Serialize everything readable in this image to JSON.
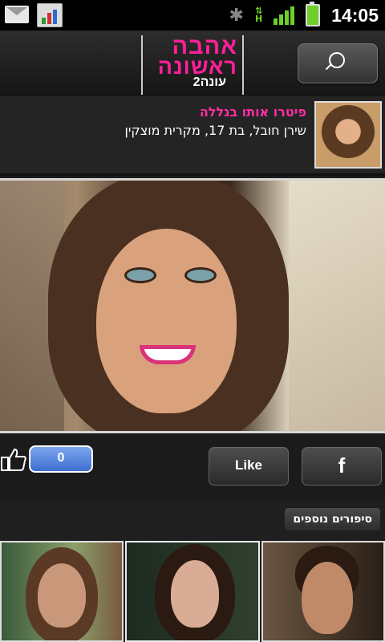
{
  "status_bar": {
    "time": "14:05",
    "icons": [
      "mail-icon",
      "stats-icon",
      "bluetooth-icon",
      "hspa-icon",
      "signal-icon",
      "battery-charging-icon"
    ]
  },
  "header": {
    "logo_line1": "אהבה",
    "logo_line2": "ראשונה",
    "logo_line3": "עונה2",
    "search_icon": "search-icon"
  },
  "story": {
    "title": "פיטרו אותו בגללה",
    "subtitle": "שירן חובל, בת 17, מקרית מוצקין"
  },
  "social": {
    "like_count": "0",
    "like_label": "Like",
    "facebook_label": "f",
    "colors": {
      "facebook_blue": "#3d6fd0"
    }
  },
  "more_stories": {
    "label": "סיפורים נוספים"
  },
  "colors": {
    "accent_pink": "#ff2da1",
    "background": "#1b1b1b"
  }
}
